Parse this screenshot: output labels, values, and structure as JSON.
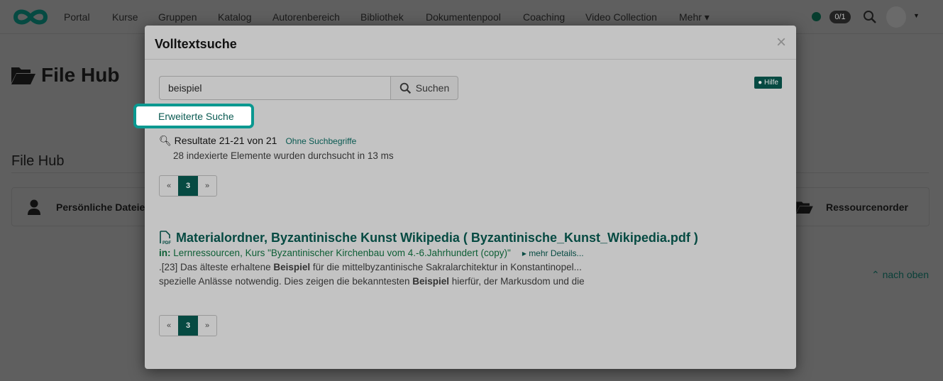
{
  "nav": {
    "items": [
      "Portal",
      "Kurse",
      "Gruppen",
      "Katalog",
      "Autorenbereich",
      "Bibliothek",
      "Dokumentenpool",
      "Coaching",
      "Video Collection",
      "Mehr ▾"
    ],
    "badge": "0/1",
    "accent": "#064a42"
  },
  "page": {
    "title": "File Hub",
    "section": "File Hub",
    "cards": [
      "Persönliche Dateien",
      "Ressourcenorder"
    ],
    "back_to_top": "nach oben"
  },
  "modal": {
    "title": "Volltextsuche",
    "close": "×",
    "search_value": "beispiel",
    "search_button": "Suchen",
    "help": "Hilfe",
    "advanced": "Erweiterte Suche",
    "results": "Resultate 21-21 von 21",
    "without_terms": "Ohne Suchbegriffe",
    "stats": "28 indexierte Elemente wurden durchsucht in 13 ms",
    "pager": {
      "prev": "«",
      "current": "3",
      "next": "»"
    },
    "hit": {
      "title": "Materialordner, Byzantinische Kunst Wikipedia ( Byzantinische_Kunst_Wikipedia.pdf )",
      "in_label": "in:",
      "location": "Lernressourcen, Kurs \"Byzantinischer Kirchenbau vom 4.-6.Jahrhundert (copy)\"",
      "more": "mehr Details...",
      "line1_pre": ".[23] Das älteste erhaltene ",
      "line1_bold": "Beispiel",
      "line1_post": " für die mittelbyzantinische Sakralarchitektur in Konstantinopel...",
      "line2_pre": "spezielle Anlässe notwendig. Dies zeigen die bekanntesten ",
      "line2_bold": "Beispiel",
      "line2_post": " hierfür, der Markusdom und die"
    }
  }
}
